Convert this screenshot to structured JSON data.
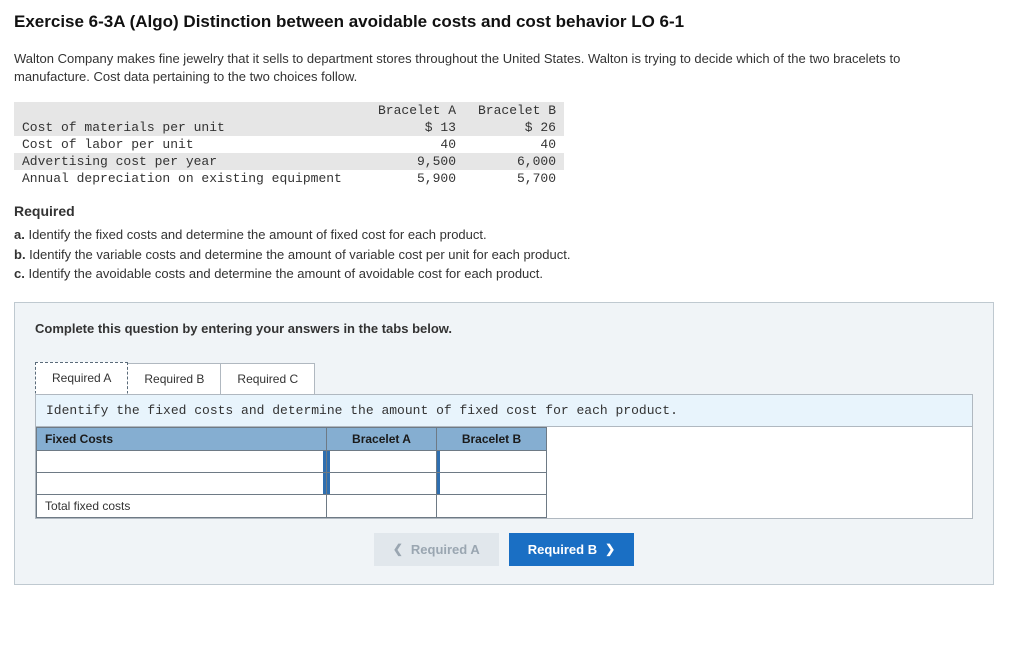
{
  "title": "Exercise 6-3A (Algo) Distinction between avoidable costs and cost behavior LO 6-1",
  "intro": "Walton Company makes fine jewelry that it sells to department stores throughout the United States. Walton is trying to decide which of the two bracelets to manufacture. Cost data pertaining to the two choices follow.",
  "cost_table": {
    "col_a": "Bracelet A",
    "col_b": "Bracelet B",
    "rows": [
      {
        "label": "Cost of materials per unit",
        "a": "$ 13",
        "b": "$ 26"
      },
      {
        "label": "Cost of labor per unit",
        "a": "40",
        "b": "40"
      },
      {
        "label": "Advertising cost per year",
        "a": "9,500",
        "b": "6,000"
      },
      {
        "label": "Annual depreciation on existing equipment",
        "a": "5,900",
        "b": "5,700"
      }
    ]
  },
  "required_heading": "Required",
  "required_items": {
    "a_lbl": "a.",
    "a_txt": " Identify the fixed costs and determine the amount of fixed cost for each product.",
    "b_lbl": "b.",
    "b_txt": " Identify the variable costs and determine the amount of variable cost per unit for each product.",
    "c_lbl": "c.",
    "c_txt": " Identify the avoidable costs and determine the amount of avoidable cost for each product."
  },
  "answer_instr": "Complete this question by entering your answers in the tabs below.",
  "tabs": {
    "a": "Required A",
    "b": "Required B",
    "c": "Required C"
  },
  "tab_a": {
    "instr": "Identify the fixed costs and determine the amount of fixed cost for each product.",
    "hdr_fixed": "Fixed Costs",
    "hdr_a": "Bracelet A",
    "hdr_b": "Bracelet B",
    "total_label": "Total fixed costs"
  },
  "nav": {
    "prev": "Required A",
    "next": "Required B"
  }
}
